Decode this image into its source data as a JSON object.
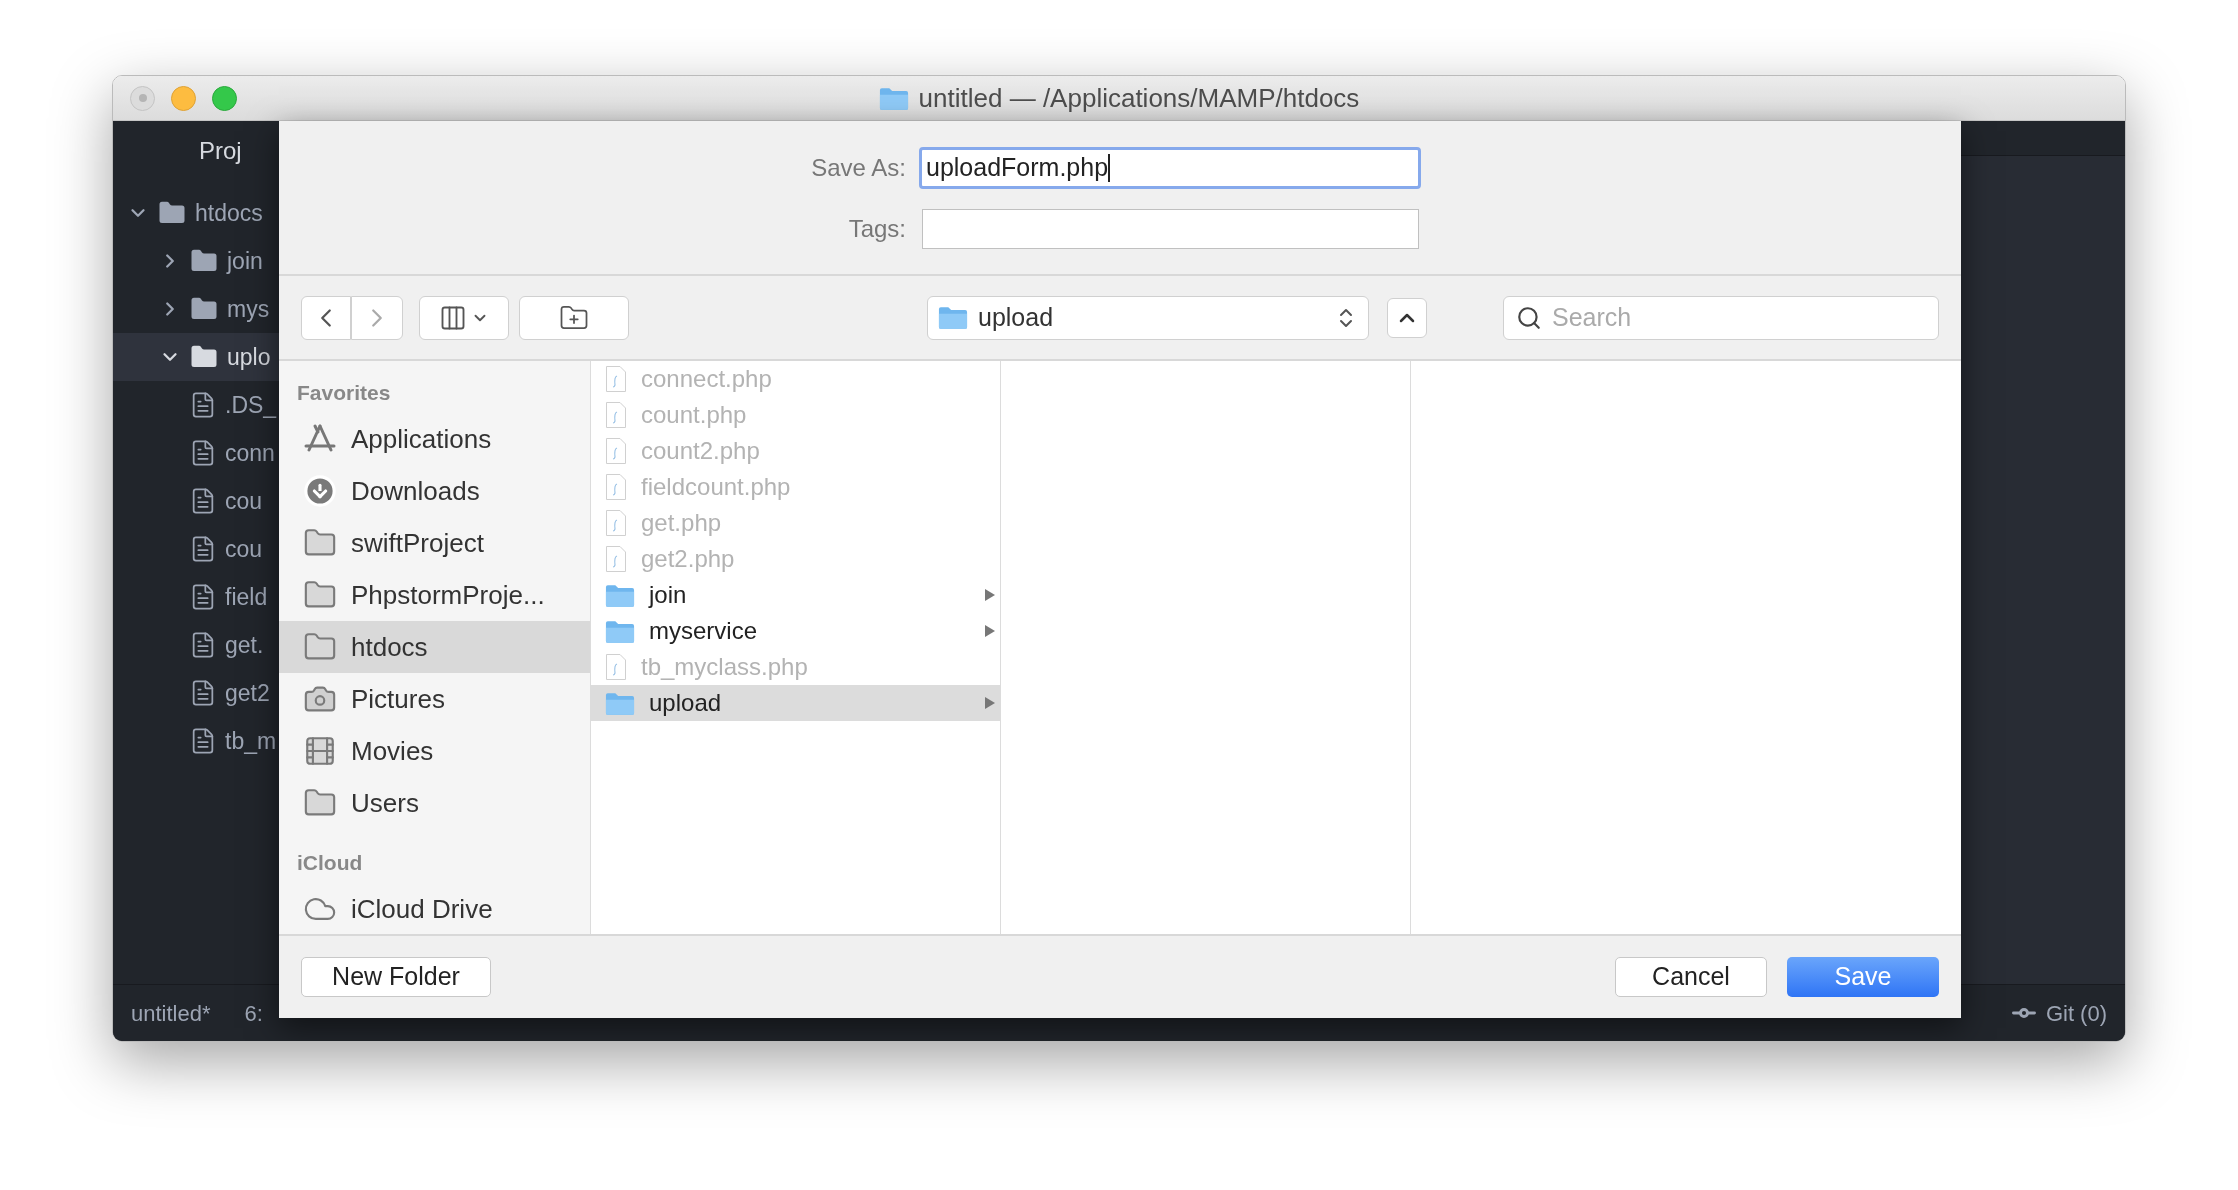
{
  "window": {
    "title": "untitled — /Applications/MAMP/htdocs"
  },
  "tree": {
    "header": "Proj",
    "items": [
      {
        "name": "htdocs",
        "kind": "folder",
        "expanded": true,
        "selected": false,
        "children": [
          {
            "name": "join",
            "kind": "folder",
            "expanded": false,
            "selected": false
          },
          {
            "name": "mys",
            "kind": "folder",
            "expanded": false,
            "selected": false
          },
          {
            "name": "uplo",
            "kind": "folder",
            "expanded": true,
            "selected": true,
            "children": [
              {
                "name": ".DS_",
                "kind": "file",
                "selected": false
              },
              {
                "name": "conn",
                "kind": "file",
                "selected": false
              },
              {
                "name": "cou",
                "kind": "file",
                "selected": false
              },
              {
                "name": "cou",
                "kind": "file",
                "selected": false
              },
              {
                "name": "field",
                "kind": "file",
                "selected": false
              },
              {
                "name": "get.",
                "kind": "file",
                "selected": false
              },
              {
                "name": "get2",
                "kind": "file",
                "selected": false
              },
              {
                "name": "tb_m",
                "kind": "file",
                "selected": false
              }
            ]
          }
        ]
      }
    ]
  },
  "dialog": {
    "save_as": {
      "label": "Save As:",
      "value": "uploadForm.php"
    },
    "tags": {
      "label": "Tags:"
    },
    "location": "upload",
    "search": {
      "placeholder": "Search"
    },
    "sidebar": [
      {
        "heading": "Favorites",
        "items": [
          {
            "name": "Applications",
            "kind": "applications",
            "selected": false
          },
          {
            "name": "Downloads",
            "kind": "downloads",
            "selected": false
          },
          {
            "name": "swiftProject",
            "kind": "folder",
            "selected": false
          },
          {
            "name": "PhpstormProje...",
            "kind": "folder",
            "selected": false
          },
          {
            "name": "htdocs",
            "kind": "folder",
            "selected": true
          },
          {
            "name": "Pictures",
            "kind": "pictures",
            "selected": false
          },
          {
            "name": "Movies",
            "kind": "movies",
            "selected": false
          },
          {
            "name": "Users",
            "kind": "folder",
            "selected": false
          }
        ]
      },
      {
        "heading": "iCloud",
        "items": [
          {
            "name": "iCloud Drive",
            "kind": "cloud",
            "selected": false
          }
        ]
      }
    ],
    "files": [
      {
        "name": "connect.php",
        "kind": "file",
        "disabled": true,
        "selected": false
      },
      {
        "name": "count.php",
        "kind": "file",
        "disabled": true,
        "selected": false
      },
      {
        "name": "count2.php",
        "kind": "file",
        "disabled": true,
        "selected": false
      },
      {
        "name": "fieldcount.php",
        "kind": "file",
        "disabled": true,
        "selected": false
      },
      {
        "name": "get.php",
        "kind": "file",
        "disabled": true,
        "selected": false
      },
      {
        "name": "get2.php",
        "kind": "file",
        "disabled": true,
        "selected": false
      },
      {
        "name": "join",
        "kind": "folder",
        "disabled": false,
        "selected": false
      },
      {
        "name": "myservice",
        "kind": "folder",
        "disabled": false,
        "selected": false
      },
      {
        "name": "tb_myclass.php",
        "kind": "file",
        "disabled": true,
        "selected": false
      },
      {
        "name": "upload",
        "kind": "folder",
        "disabled": false,
        "selected": true
      }
    ],
    "buttons": {
      "new_folder": "New Folder",
      "cancel": "Cancel",
      "save": "Save"
    }
  },
  "status_bar": {
    "left": [
      "untitled*",
      "6:"
    ],
    "git": "Git (0)"
  }
}
